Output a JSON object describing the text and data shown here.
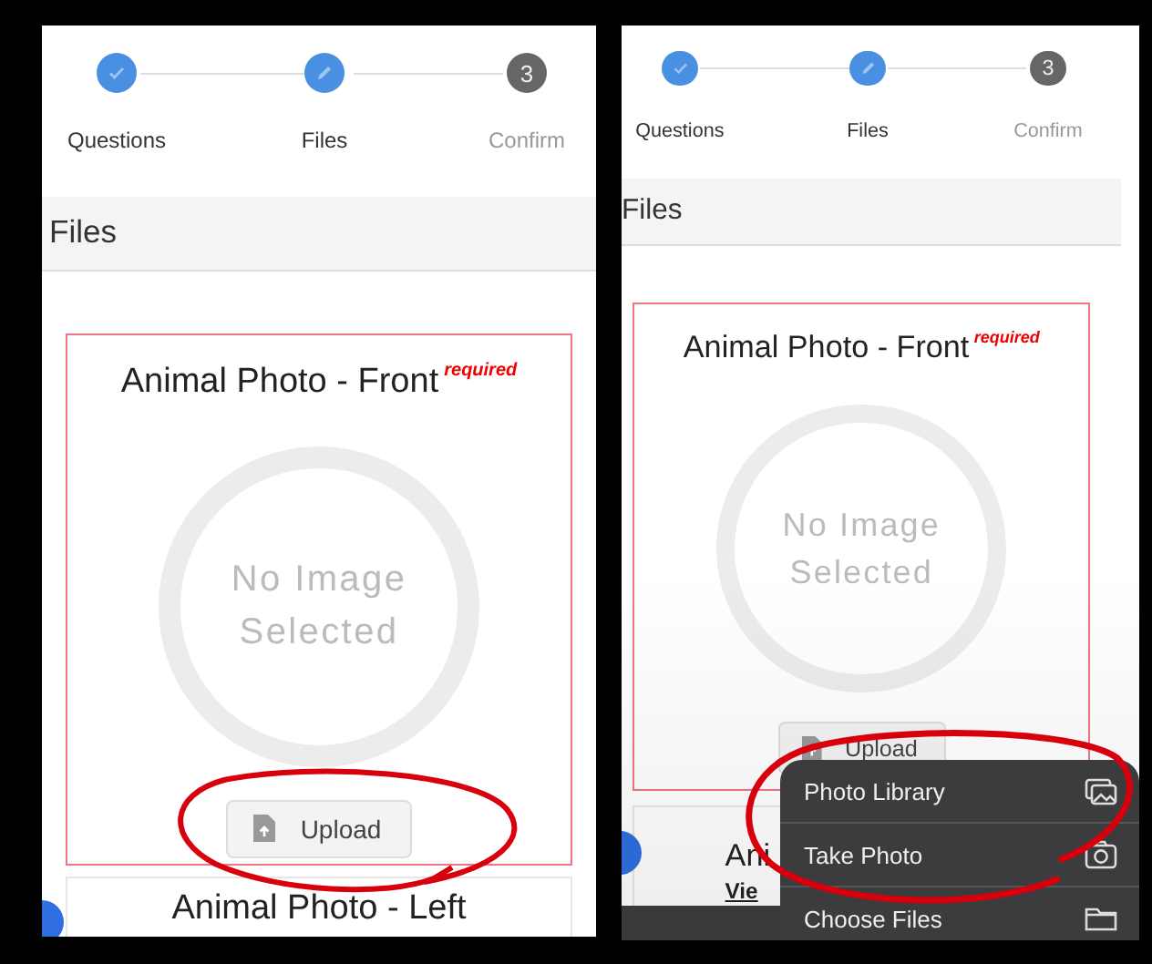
{
  "panels": [
    {
      "steps": [
        {
          "label": "Questions",
          "kind": "done"
        },
        {
          "label": "Files",
          "kind": "editing"
        },
        {
          "label": "Confirm",
          "kind": "pending",
          "number": "3"
        }
      ],
      "section_title": "Files",
      "cards": [
        {
          "kind": "upload",
          "title": "Animal Photo - Front",
          "badge": "required",
          "placeholder": "No Image Selected",
          "button": "Upload"
        },
        {
          "kind": "partial",
          "title": "Animal Photo - Left"
        }
      ]
    },
    {
      "steps": [
        {
          "label": "Questions",
          "kind": "done"
        },
        {
          "label": "Files",
          "kind": "editing"
        },
        {
          "label": "Confirm",
          "kind": "pending",
          "number": "3"
        }
      ],
      "section_title": "Files",
      "cards": [
        {
          "kind": "upload",
          "title": "Animal Photo - Front",
          "badge": "required",
          "placeholder": "No Image Selected",
          "button": "Upload"
        },
        {
          "kind": "partial",
          "title": "Ani",
          "link": "Vie"
        }
      ],
      "menu": [
        {
          "label": "Photo Library"
        },
        {
          "label": "Take Photo"
        },
        {
          "label": "Choose Files"
        }
      ]
    }
  ]
}
